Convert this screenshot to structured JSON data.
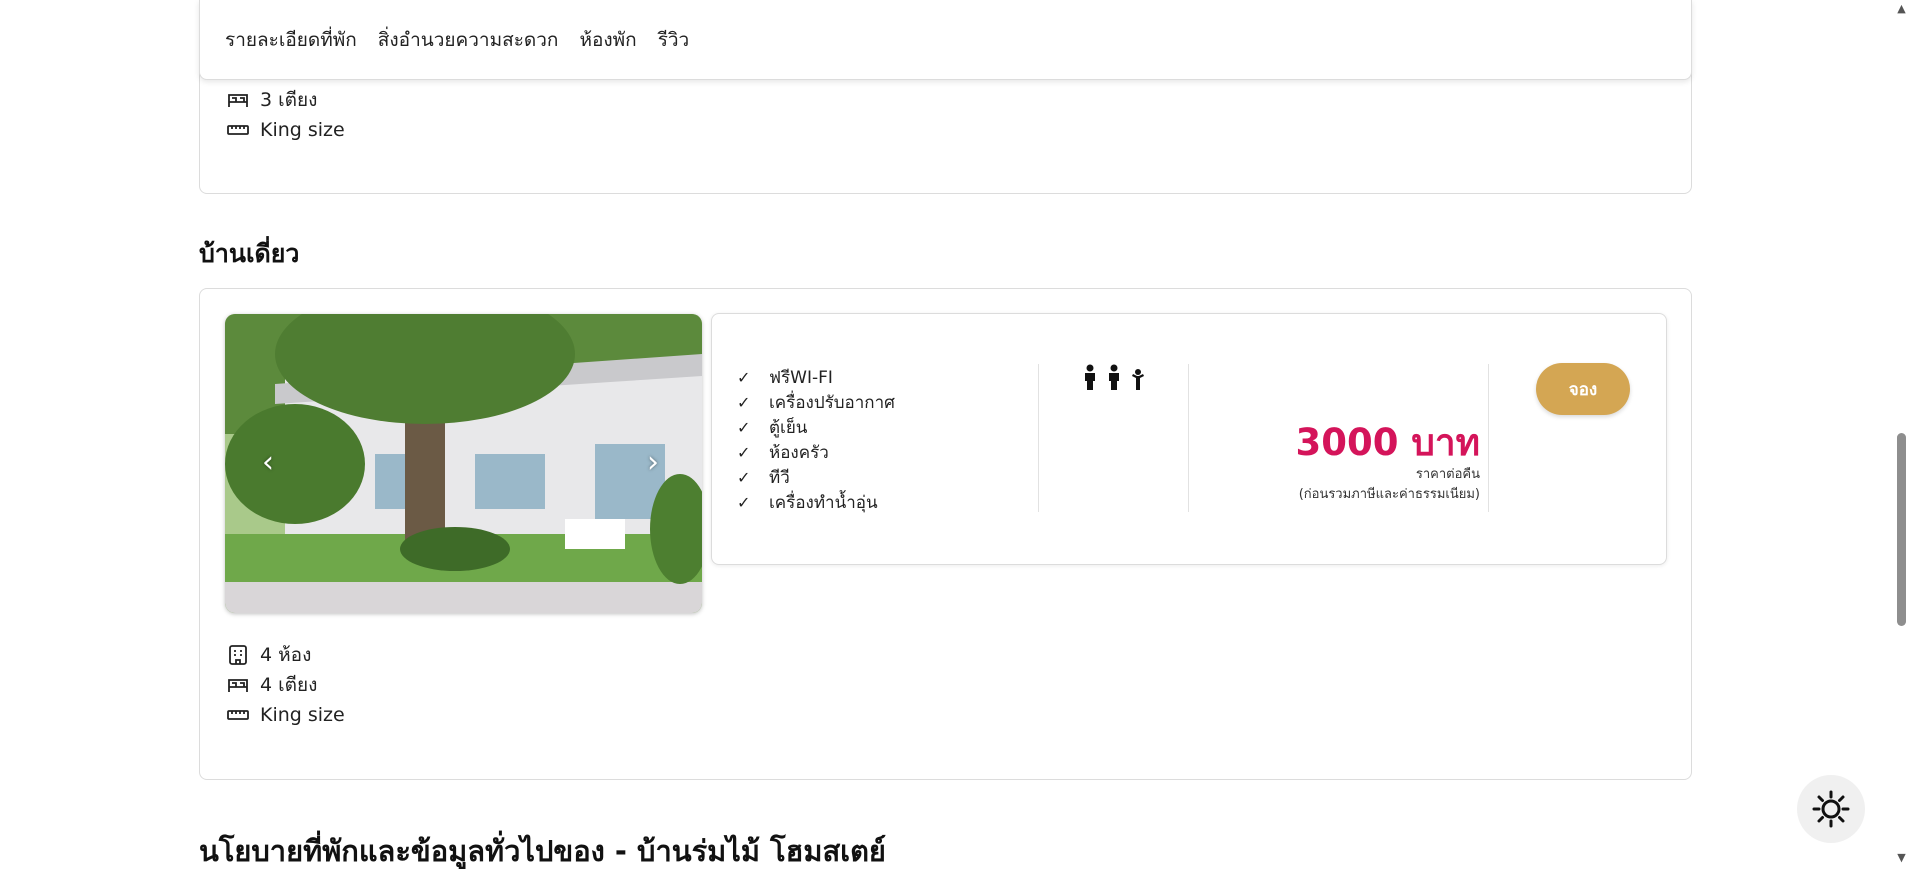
{
  "nav": {
    "tabs": [
      {
        "label": "รายละเอียดที่พัก"
      },
      {
        "label": "สิ่งอำนวยความสะดวก"
      },
      {
        "label": "ห้องพัก"
      },
      {
        "label": "รีวิว"
      }
    ]
  },
  "previous_room": {
    "beds": "3 เตียง",
    "bed_size": "King size"
  },
  "room": {
    "title": "บ้านเดี่ยว",
    "photo_icons": [
      "chevron-left-icon",
      "chevron-right-icon"
    ],
    "amenities": [
      {
        "label": "ฟรีWI-FI"
      },
      {
        "label": "เครื่องปรับอากาศ"
      },
      {
        "label": "ตู้เย็น"
      },
      {
        "label": "ห้องครัว"
      },
      {
        "label": "ทีวี"
      },
      {
        "label": "เครื่องทำน้ำอุ่น"
      }
    ],
    "check_mark": "✓",
    "guest_icons": [
      "adult-icon",
      "adult-icon",
      "child-icon"
    ],
    "price": "3000 บาท",
    "price_unit": "ราคาต่อคืน",
    "price_note": "(ก่อนรวมภาษีและค่าธรรมเนียม)",
    "book_label": "จอง",
    "rooms": "4 ห้อง",
    "beds": "4 เตียง",
    "bed_size": "King size"
  },
  "policy": {
    "title": "นโยบายที่พักและข้อมูลทั่วไปของ - บ้านร่มไม้ โฮมสเตย์"
  },
  "colors": {
    "price": "#d4145a",
    "book_button": "#d4a653",
    "border": "#dcdcdc"
  }
}
